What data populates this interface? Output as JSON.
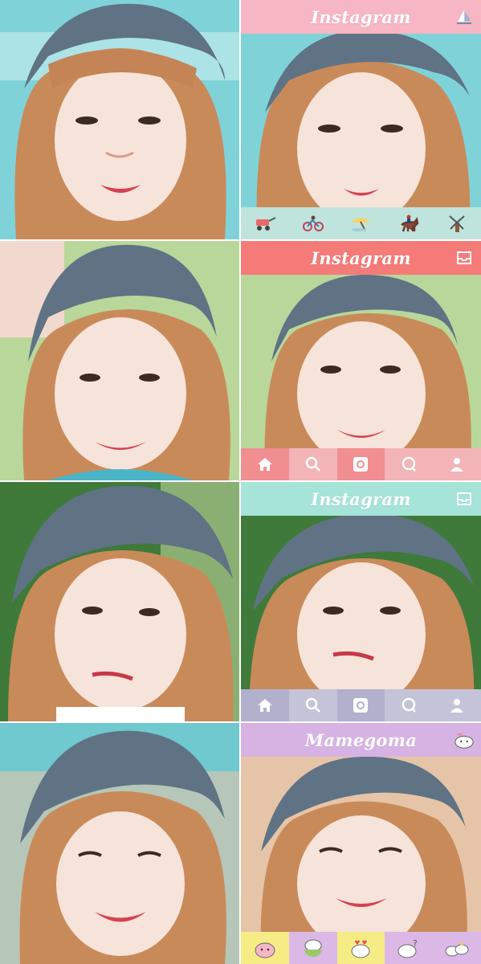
{
  "colors": {
    "pink_header": "#f6b6c4",
    "mint_bar": "#bfe4dd",
    "coral_header": "#f57b78",
    "pink_bar": "#f3b4b8",
    "mint_header": "#a6e3d8",
    "lavender_bar": "#c4c3d8",
    "lilac_header": "#d7b3e4",
    "yellow_bar": "#f5ec86",
    "lilac_bar": "#dbb8e6"
  },
  "panels": [
    {
      "title": "Instagram",
      "icon": "sailboat-icon",
      "bar": [
        "cart-icon",
        "bicycle-icon",
        "beach-umbrella-icon",
        "horse-rider-icon",
        "windmill-icon"
      ]
    },
    {
      "title": "Instagram",
      "icon": "inbox-icon",
      "bar": [
        "home-icon",
        "search-icon",
        "camera-icon",
        "comment-icon",
        "profile-icon"
      ]
    },
    {
      "title": "Instagram",
      "icon": "inbox-icon",
      "bar": [
        "home-icon",
        "search-icon",
        "camera-icon",
        "comment-icon",
        "profile-icon"
      ]
    },
    {
      "title": "Mamegoma",
      "icon": "seal-mascot-icon",
      "bar": [
        "seal-pink-icon",
        "seal-bowl-icon",
        "seal-hearts-icon",
        "seal-question-icon",
        "seal-pair-icon"
      ]
    }
  ]
}
